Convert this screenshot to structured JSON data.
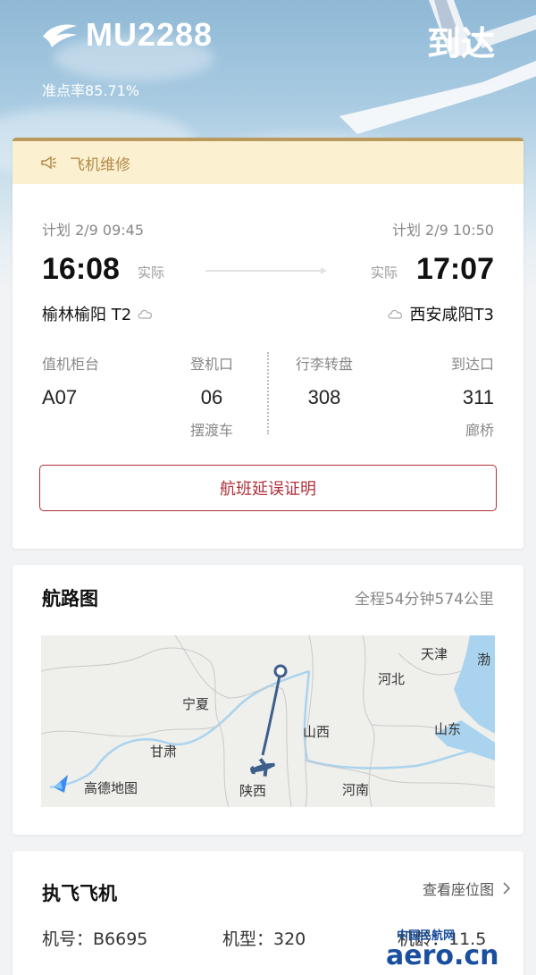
{
  "header": {
    "flight_no": "MU2288",
    "status": "到达",
    "ontime_rate": "准点率85.71%"
  },
  "notice": {
    "text": "飞机维修",
    "icon": "megaphone-icon"
  },
  "schedule": {
    "dep_plan": "计划 2/9 09:45",
    "arr_plan": "计划 2/9 10:50",
    "dep_actual_time": "16:08",
    "arr_actual_time": "17:07",
    "actual_label_dep": "实际",
    "actual_label_arr": "实际",
    "dep_airport": "榆林榆阳 T2",
    "arr_airport": "西安咸阳T3"
  },
  "info": {
    "checkin_label": "值机柜台",
    "checkin_value": "A07",
    "gate_label": "登机口",
    "gate_value": "06",
    "gate_sub": "摆渡车",
    "baggage_label": "行李转盘",
    "baggage_value": "308",
    "exit_label": "到达口",
    "exit_value": "311",
    "exit_sub": "廊桥"
  },
  "delay_button": "航班延误证明",
  "route": {
    "title": "航路图",
    "summary": "全程54分钟574公里",
    "map_labels": {
      "tianjin": "天津",
      "bo": "渤",
      "hebei": "河北",
      "ningxia": "宁夏",
      "shanxi": "山西",
      "shandong": "山东",
      "gansu": "甘肃",
      "shaanxi": "陕西",
      "henan": "河南",
      "amap": "高德地图"
    }
  },
  "plane": {
    "title": "执飞飞机",
    "seat_map": "查看座位图",
    "reg": "机号：B6695",
    "type": "机型：320",
    "age": "机龄：11.5"
  },
  "watermark": {
    "top": "中国民航网",
    "bottom": "aero.cn"
  },
  "colors": {
    "accent_red": "#b0303a",
    "gold": "#b9995d",
    "notice_bg": "#fbf0cf",
    "route_line": "#3d5f8c"
  }
}
